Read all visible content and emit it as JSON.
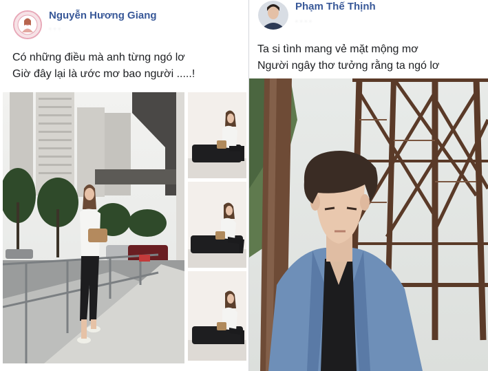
{
  "left_post": {
    "author": "Nguyễn Hương Giang",
    "meta": "· · ·",
    "lines": [
      "Có những điều mà anh từng ngó lơ",
      "Giờ đây lại là ước mơ bao người .....!"
    ],
    "photos": [
      "main-street-photo",
      "bench-photo-1",
      "bench-photo-2",
      "bench-photo-3"
    ]
  },
  "right_post": {
    "author": "Phạm Thế Thịnh",
    "meta": "· · · ·",
    "lines": [
      "Ta si tình mang vẻ mặt mộng mơ",
      "Người ngây thơ tưởng rằng ta ngó lơ"
    ],
    "photos": [
      "bridge-portrait-photo"
    ]
  },
  "colors": {
    "author_link": "#385898",
    "text": "#1c1e21",
    "divider": "#d4d6da",
    "bridge_steel": "#5a3a28",
    "denim": "#6e8fb8"
  }
}
